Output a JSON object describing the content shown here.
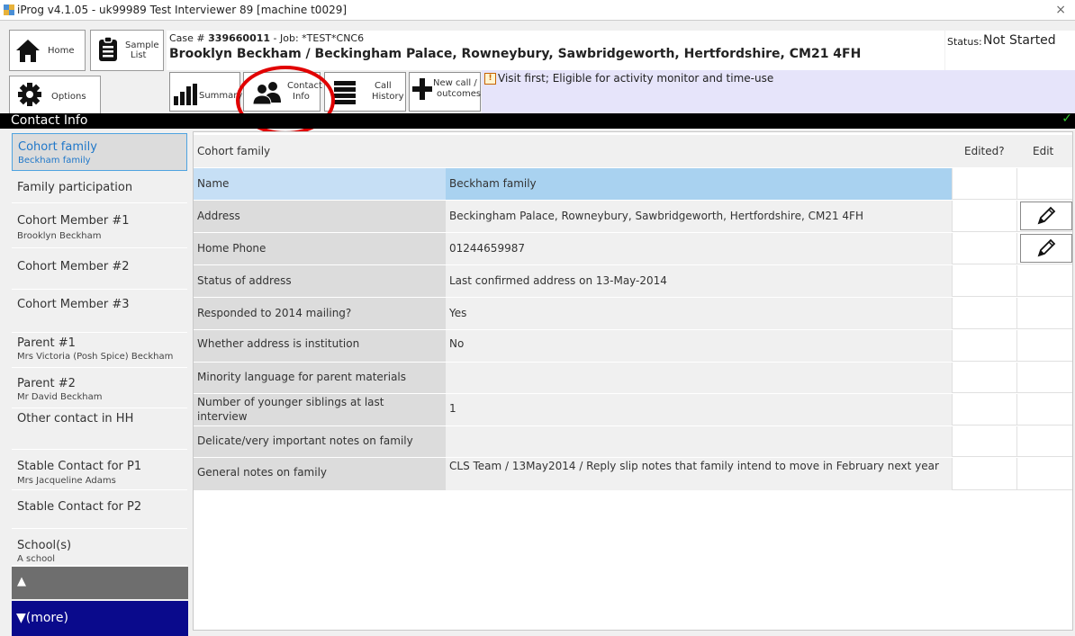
{
  "window": {
    "title": "iProg v4.1.05 - uk99989 Test Interviewer 89 [machine t0029]",
    "close": "×"
  },
  "toolbar": {
    "home_label": "Home",
    "sample_label_1": "Sample",
    "sample_label_2": "List",
    "options_label": "Options"
  },
  "case": {
    "prefix": "Case # ",
    "number": "339660011",
    "job": " - Job: *TEST*CNC6",
    "address_line": "Brooklyn Beckham / Beckingham Palace, Rowneybury, Sawbridgeworth, Hertfordshire, CM21 4FH"
  },
  "status": {
    "label": "Status:",
    "value": "Not Started"
  },
  "tabs": {
    "summary": "Summary",
    "contact_1": "Contact",
    "contact_2": "Info",
    "call_1": "Call",
    "call_2": "History",
    "new_1": "New call /",
    "new_2": "outcomes"
  },
  "notice": {
    "icon": "!",
    "text": "Visit first; Eligible for activity monitor and time-use"
  },
  "section": {
    "title": "Contact Info",
    "check": "✓"
  },
  "sidebar": {
    "items": [
      {
        "label": "Cohort family",
        "sub": "Beckham family"
      },
      {
        "label": "Family participation",
        "sub": ""
      },
      {
        "label": "Cohort Member #1",
        "sub": "Brooklyn Beckham"
      },
      {
        "label": "Cohort Member #2",
        "sub": ""
      },
      {
        "label": "Cohort Member #3",
        "sub": ""
      },
      {
        "label": "Parent #1",
        "sub": "Mrs Victoria (Posh Spice) Beckham"
      },
      {
        "label": "Parent #2",
        "sub": "Mr David Beckham"
      },
      {
        "label": "Other contact in HH",
        "sub": ""
      },
      {
        "label": "Stable Contact for P1",
        "sub": "Mrs Jacqueline Adams"
      },
      {
        "label": "Stable Contact for P2",
        "sub": ""
      },
      {
        "label": "School(s)",
        "sub": "A school"
      }
    ],
    "up": "▲",
    "more": "▼(more)"
  },
  "table": {
    "header": {
      "label": "Cohort family",
      "value": "",
      "edited": "Edited?",
      "edit": "Edit"
    },
    "rows": [
      {
        "label": "Name",
        "value": "Beckham family"
      },
      {
        "label": "Address",
        "value": "Beckingham Palace, Rowneybury, Sawbridgeworth, Hertfordshire, CM21 4FH"
      },
      {
        "label": "Home Phone",
        "value": "01244659987"
      },
      {
        "label": "Status of address",
        "value": "Last confirmed address on 13-May-2014"
      },
      {
        "label": "Responded to 2014 mailing?",
        "value": "Yes"
      },
      {
        "label": "Whether address is institution",
        "value": "No"
      },
      {
        "label": "Minority language for parent materials",
        "value": ""
      },
      {
        "label": "Number of younger siblings at last interview",
        "value": "1"
      },
      {
        "label": "Delicate/very important notes on family",
        "value": ""
      },
      {
        "label": "General notes on family",
        "value": "CLS Team / 13May2014 / Reply slip notes that family intend to move in February next year"
      }
    ]
  }
}
